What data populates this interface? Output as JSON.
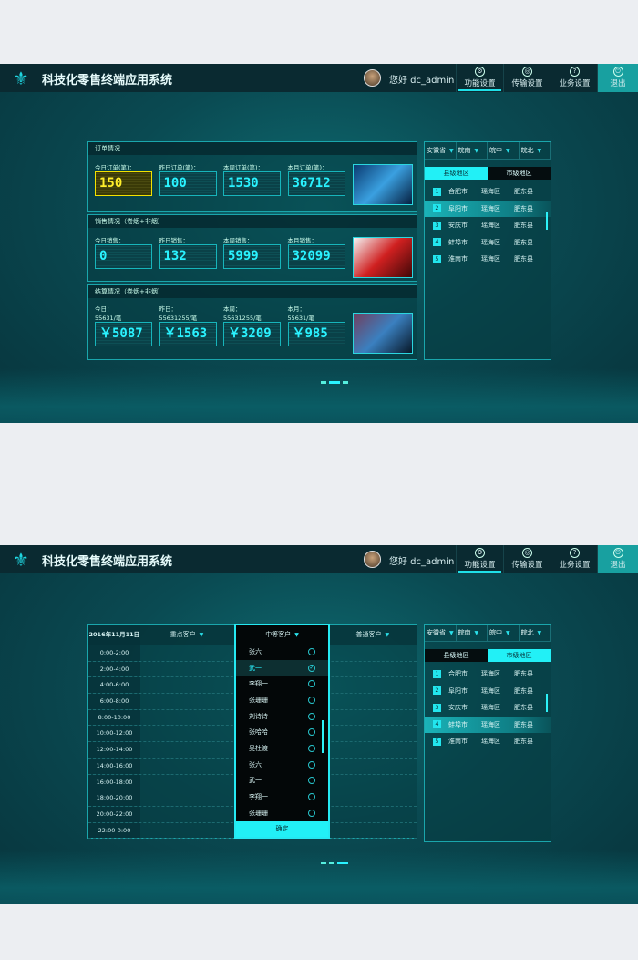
{
  "app": {
    "title": "科技化零售终端应用系统",
    "greeting": "您好 dc_admin",
    "nav": [
      {
        "label": "功能设置",
        "icon": "gear-icon",
        "glyph": "⚙"
      },
      {
        "label": "传输设置",
        "icon": "transfer-icon",
        "glyph": "◎"
      },
      {
        "label": "业务设置",
        "icon": "help-icon",
        "glyph": "?"
      },
      {
        "label": "退出",
        "icon": "power-icon",
        "glyph": "⏻"
      }
    ],
    "accent": "#22f0f6",
    "highlight": "#f2e200"
  },
  "screen1": {
    "sections": [
      {
        "title": "订单情况",
        "cells": [
          {
            "label": "今日订单(笔)：",
            "value": "150"
          },
          {
            "label": "昨日订单(笔)：",
            "value": "100"
          },
          {
            "label": "本周订单(笔)：",
            "value": "1530"
          },
          {
            "label": "本月订单(笔)：",
            "value": "36712"
          }
        ]
      },
      {
        "title": "销售情况（卷烟+非烟）",
        "cells": [
          {
            "label": "今日销售：",
            "value": "0"
          },
          {
            "label": "昨日销售：",
            "value": "132"
          },
          {
            "label": "本周销售：",
            "value": "5999"
          },
          {
            "label": "本月销售：",
            "value": "32099"
          }
        ]
      },
      {
        "title": "结算情况（卷烟+非烟）",
        "cells": [
          {
            "label": "今日：",
            "sub": "55631/笔",
            "value": "￥5087"
          },
          {
            "label": "昨日：",
            "sub": "55631255/笔",
            "value": "￥1563"
          },
          {
            "label": "本周：",
            "sub": "55631255/笔",
            "value": "￥3209"
          },
          {
            "label": "本月：",
            "sub": "55631/笔",
            "value": "￥985"
          }
        ]
      }
    ],
    "region": {
      "selects": [
        "安徽省",
        "皖南",
        "皖中",
        "皖北"
      ],
      "tabs": [
        "县级地区",
        "市级地区"
      ],
      "active_tab": 0,
      "highlight_row": 1,
      "rows": [
        {
          "n": "1",
          "city": "合肥市",
          "district": "瑶海区",
          "county": "肥东县"
        },
        {
          "n": "2",
          "city": "阜阳市",
          "district": "瑶海区",
          "county": "肥东县"
        },
        {
          "n": "3",
          "city": "安庆市",
          "district": "瑶海区",
          "county": "肥东县"
        },
        {
          "n": "4",
          "city": "蚌埠市",
          "district": "瑶海区",
          "county": "肥东县"
        },
        {
          "n": "5",
          "city": "淮南市",
          "district": "瑶海区",
          "county": "肥东县"
        }
      ]
    },
    "page": 2
  },
  "screen2": {
    "date": "2016年11月11日",
    "columns": [
      "重点客户",
      "中等客户",
      "普通客户"
    ],
    "times": [
      "0:00-2:00",
      "2:00-4:00",
      "4:00-6:00",
      "6:00-8:00",
      "8:00-10:00",
      "10:00-12:00",
      "12:00-14:00",
      "14:00-16:00",
      "16:00-18:00",
      "18:00-20:00",
      "20:00-22:00",
      "22:00-0:00"
    ],
    "popup": {
      "items": [
        "张六",
        "武一",
        "李翔一",
        "张珊珊",
        "刘诗诗",
        "张哈哈",
        "吴杜渡",
        "张六",
        "武一",
        "李翔一",
        "张珊珊"
      ],
      "selected": 1,
      "confirm": "确定"
    },
    "region": {
      "selects": [
        "安徽省",
        "皖南",
        "皖中",
        "皖北"
      ],
      "tabs": [
        "县级地区",
        "市级地区"
      ],
      "active_tab": 1,
      "highlight_row": 3,
      "rows": [
        {
          "n": "1",
          "city": "合肥市",
          "district": "瑶海区",
          "county": "肥东县"
        },
        {
          "n": "2",
          "city": "阜阳市",
          "district": "瑶海区",
          "county": "肥东县"
        },
        {
          "n": "3",
          "city": "安庆市",
          "district": "瑶海区",
          "county": "肥东县"
        },
        {
          "n": "4",
          "city": "蚌埠市",
          "district": "瑶海区",
          "county": "肥东县"
        },
        {
          "n": "5",
          "city": "淮南市",
          "district": "瑶海区",
          "county": "肥东县"
        }
      ]
    },
    "page": 3
  }
}
